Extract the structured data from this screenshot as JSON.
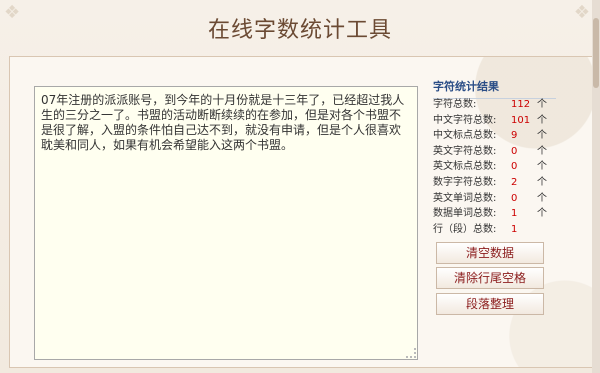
{
  "header": {
    "title": "在线字数统计工具"
  },
  "editor": {
    "value": "07年注册的派派账号，到今年的十月份就是十三年了，已经超过我人生的三分之一了。书盟的活动断断续续的在参加，但是对各个书盟不是很了解，入盟的条件怕自己达不到，就没有申请，但是个人很喜欢耽美和同人，如果有机会希望能入这两个书盟。"
  },
  "results": {
    "title": "字符统计结果",
    "rows": [
      {
        "label": "字符总数:",
        "value": "112",
        "unit": "个"
      },
      {
        "label": "中文字符总数:",
        "value": "101",
        "unit": "个"
      },
      {
        "label": "中文标点总数:",
        "value": "9",
        "unit": "个"
      },
      {
        "label": "英文字符总数:",
        "value": "0",
        "unit": "个"
      },
      {
        "label": "英文标点总数:",
        "value": "0",
        "unit": "个"
      },
      {
        "label": "数字字符总数:",
        "value": "2",
        "unit": "个"
      },
      {
        "label": "英文单词总数:",
        "value": "0",
        "unit": "个"
      },
      {
        "label": "数据单词总数:",
        "value": "1",
        "unit": "个"
      },
      {
        "label": "行（段）总数:",
        "value": "1",
        "unit": ""
      }
    ]
  },
  "buttons": {
    "clear": "清空数据",
    "trim": "清除行尾空格",
    "format": "段落整理"
  },
  "colors": {
    "title": "#6b4a33",
    "accent_red": "#cc0000",
    "section_blue": "#2a4d86",
    "button_text": "#8b1c1c"
  }
}
